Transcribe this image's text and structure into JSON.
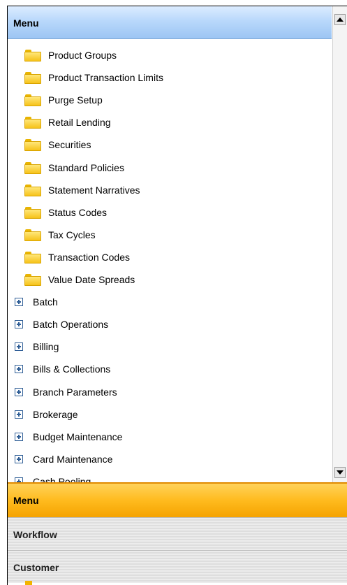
{
  "menu_header": {
    "title": "Menu"
  },
  "tree": {
    "folders": [
      "Product Groups",
      "Product Transaction Limits",
      "Purge Setup",
      "Retail Lending",
      "Securities",
      "Standard Policies",
      "Statement Narratives",
      "Status Codes",
      "Tax Cycles",
      "Transaction Codes",
      "Value Date Spreads"
    ],
    "groups": [
      "Batch",
      "Batch Operations",
      "Billing",
      "Bills & Collections",
      "Branch Parameters",
      "Brokerage",
      "Budget Maintenance",
      "Card Maintenance",
      "Cash Pooling"
    ]
  },
  "icons": {
    "folder": "folder-icon",
    "expand": "plus-box-icon",
    "scroll_up": "arrow-up-icon",
    "scroll_down": "arrow-down-icon"
  },
  "nav": {
    "menu": "Menu",
    "workflow": "Workflow",
    "customer": "Customer"
  },
  "colors": {
    "header_blue": "#b9d8fb",
    "active_orange": "#ffbb1e",
    "folder_yellow": "#f6c21a"
  }
}
